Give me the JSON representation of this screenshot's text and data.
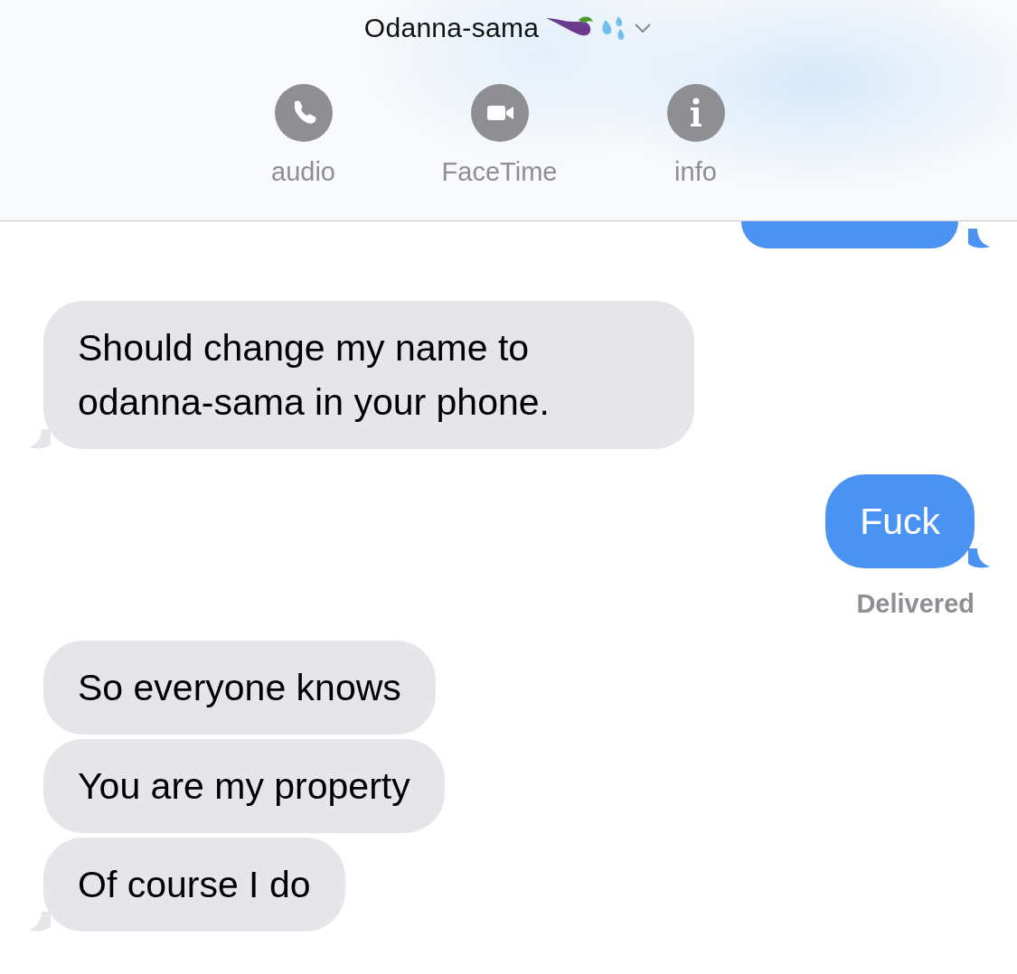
{
  "header": {
    "contact_name": "Odanna-sama",
    "actions": [
      {
        "label": "audio",
        "kind": "audio"
      },
      {
        "label": "FaceTime",
        "kind": "facetime"
      },
      {
        "label": "info",
        "kind": "info"
      }
    ]
  },
  "messages": [
    {
      "kind": "sent",
      "cut": true,
      "tail": true
    },
    {
      "kind": "received",
      "tail": true,
      "text": "Should change my name to odanna-sama in your phone."
    },
    {
      "kind": "sent",
      "tail": true,
      "text": "Fuck",
      "status": "Delivered"
    },
    {
      "kind": "received",
      "tail": false,
      "text": "So everyone knows"
    },
    {
      "kind": "received",
      "tail": false,
      "text": "You are my property"
    },
    {
      "kind": "received",
      "tail": true,
      "text": "Of course I do"
    }
  ]
}
